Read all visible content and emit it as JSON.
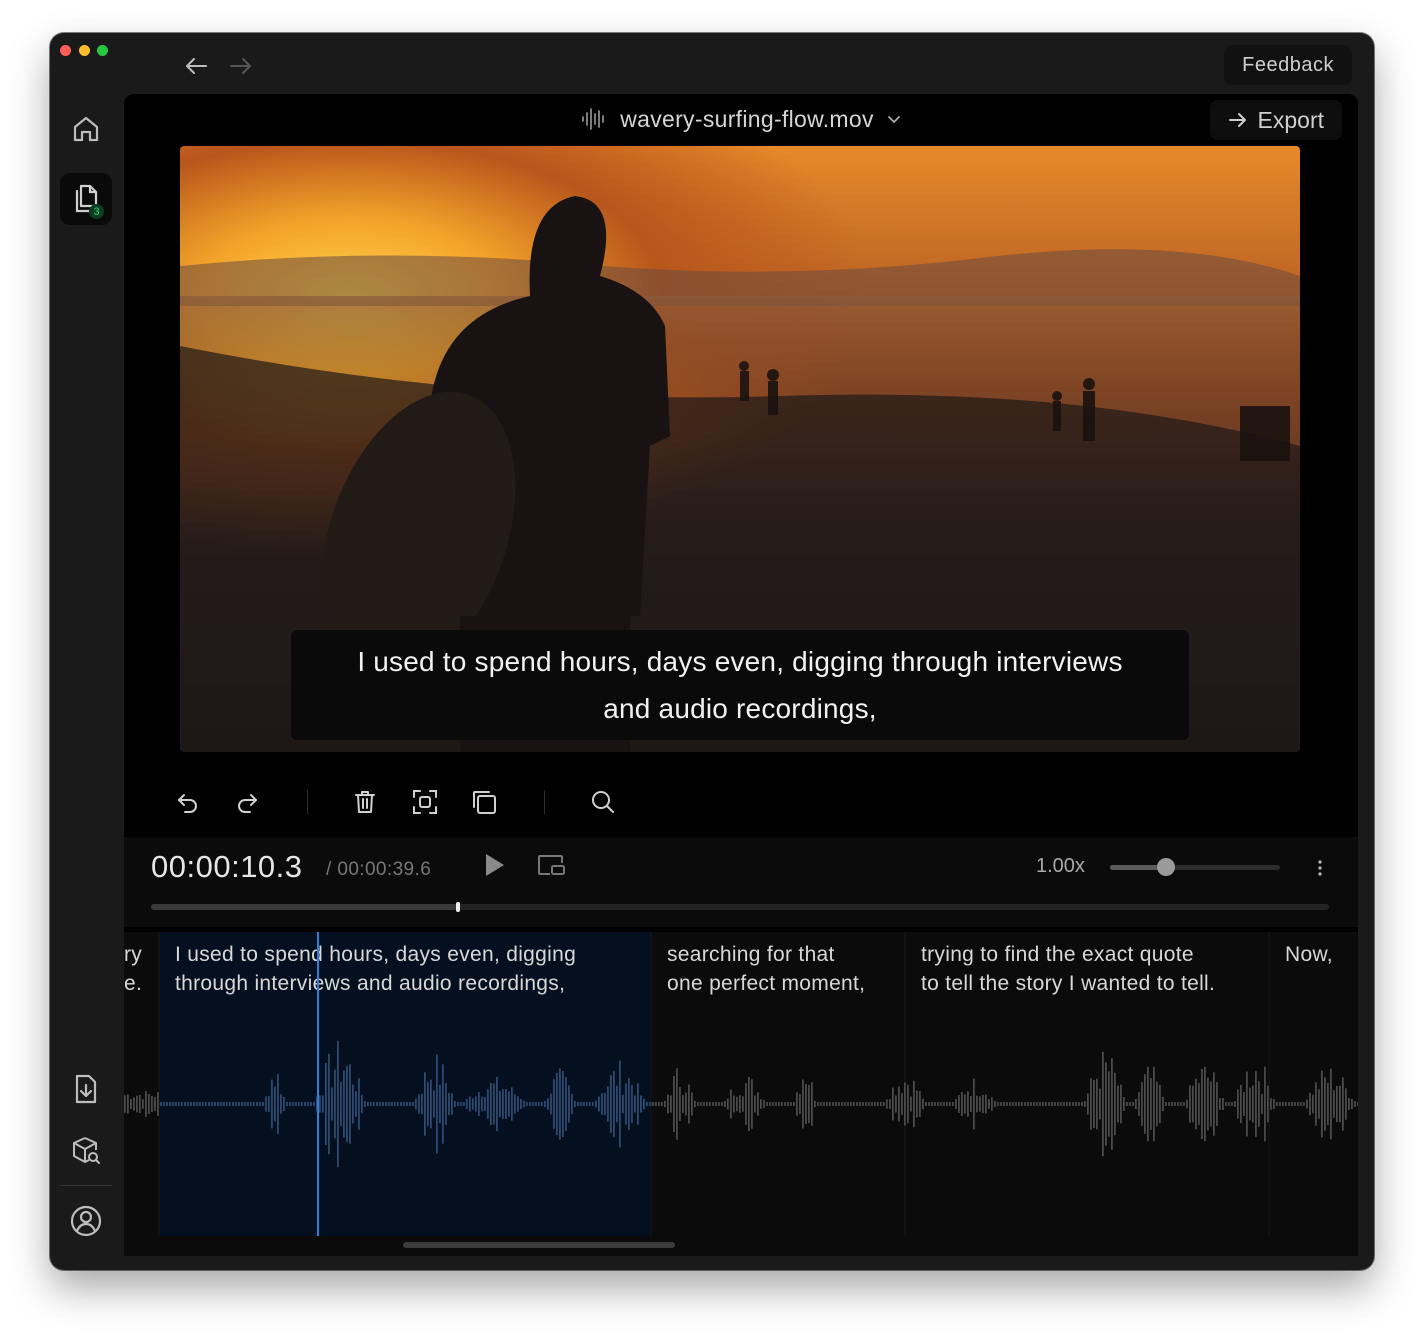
{
  "window": {
    "traffic_colors": [
      "#ff5f57",
      "#febc2e",
      "#28c840"
    ],
    "feedback_label": "Feedback"
  },
  "sidebar": {
    "items": [
      {
        "name": "home",
        "icon": "home-icon"
      },
      {
        "name": "files",
        "icon": "files-icon",
        "badge": "3"
      },
      {
        "name": "import",
        "icon": "import-icon"
      },
      {
        "name": "packages",
        "icon": "package-search-icon"
      },
      {
        "name": "account",
        "icon": "user-circle-icon"
      }
    ]
  },
  "editor": {
    "file_name": "wavery-surfing-flow.mov",
    "export_label": "Export",
    "caption_line1": "I used to spend hours, days even, digging through interviews",
    "caption_line2": "and audio recordings,"
  },
  "toolbar": {
    "tools": [
      "undo-icon",
      "redo-icon",
      "trash-icon",
      "focus-crop-icon",
      "duplicate-icon",
      "search-icon"
    ]
  },
  "player": {
    "current_time": "00:00:10.3",
    "total_time": "/ 00:00:39.6",
    "speed": "1.00x",
    "speed_fraction": 0.33,
    "progress_fraction": 0.26
  },
  "timeline": {
    "segments": [
      {
        "line1": "ry",
        "line2": "e."
      },
      {
        "line1": "I used to spend hours, days even, digging",
        "line2": "through  interviews  and  audio  recordings,"
      },
      {
        "line1": "searching for that",
        "line2": "one perfect moment,"
      },
      {
        "line1": "trying to find the exact quote",
        "line2": "to tell the story I wanted to tell."
      },
      {
        "line1": "Now,",
        "line2": ""
      }
    ],
    "active_color": "#04101f",
    "playhead_color": "#2f7de0"
  }
}
